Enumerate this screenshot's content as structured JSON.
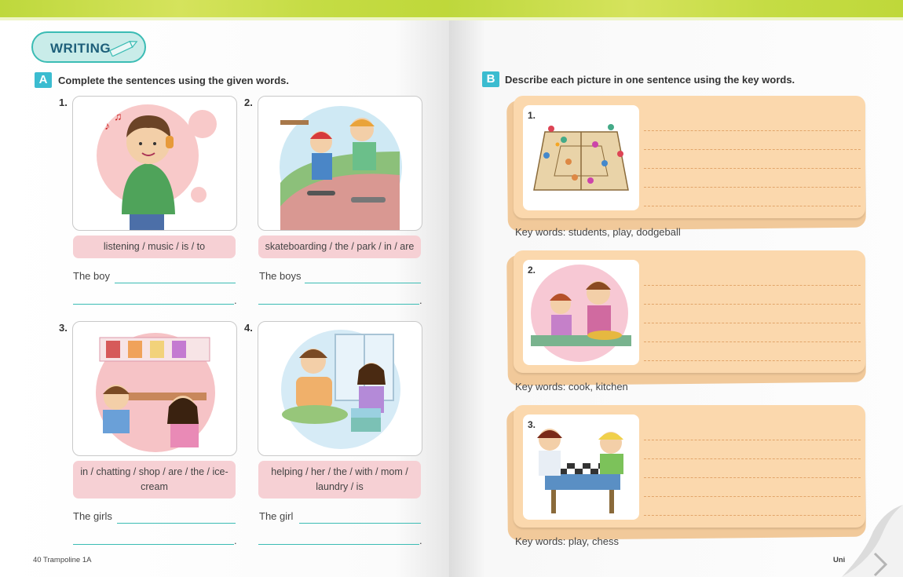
{
  "left_page": {
    "badge": "WRITING",
    "section_a": {
      "letter": "A",
      "instruction": "Complete the sentences using the given words.",
      "items": [
        {
          "num": "1.",
          "words": "listening / music / is / to",
          "starter": "The boy",
          "end": "."
        },
        {
          "num": "2.",
          "words": "skateboarding / the / park / in / are",
          "starter": "The boys",
          "end": "."
        },
        {
          "num": "3.",
          "words": "in / chatting / shop / are / the / ice-cream",
          "starter": "The girls",
          "end": "."
        },
        {
          "num": "4.",
          "words": "helping / her / the / with / mom / laundry / is",
          "starter": "The girl",
          "end": "."
        }
      ]
    },
    "footer": "40 Trampoline 1A"
  },
  "right_page": {
    "section_b": {
      "letter": "B",
      "instruction": "Describe each picture in one sentence using the key words.",
      "items": [
        {
          "num": "1.",
          "key_words": "Key words: students, play, dodgeball"
        },
        {
          "num": "2.",
          "key_words": "Key words: cook, kitchen"
        },
        {
          "num": "3.",
          "key_words": "Key words: play, chess"
        }
      ]
    },
    "footer": "Uni"
  },
  "colors": {
    "top_bar": "#c5dc44",
    "accent_teal": "#3bbcb4",
    "word_box_pink": "#f6d0d4",
    "card_orange": "#fbd8ad"
  }
}
